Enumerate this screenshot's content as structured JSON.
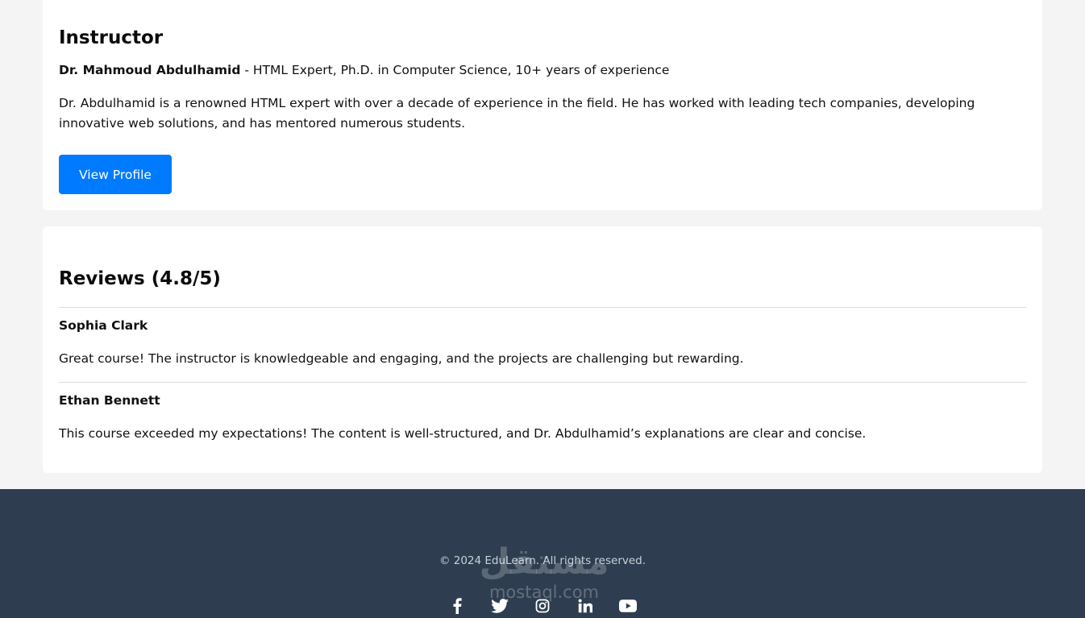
{
  "instructor": {
    "heading": "Instructor",
    "name": "Dr. Mahmoud Abdulhamid",
    "credentials": " - HTML Expert, Ph.D. in Computer Science, 10+ years of experience",
    "bio": "Dr. Abdulhamid is a renowned HTML expert with over a decade of experience in the field. He has worked with leading tech companies, developing innovative web solutions, and has mentored numerous students.",
    "button_label": "View Profile"
  },
  "reviews": {
    "heading": "Reviews (4.8/5)",
    "items": [
      {
        "name": "Sophia Clark",
        "text": "Great course! The instructor is knowledgeable and engaging, and the projects are challenging but rewarding."
      },
      {
        "name": "Ethan Bennett",
        "text": "This course exceeded my expectations! The content is well-structured, and Dr. Abdulhamid’s explanations are clear and concise."
      }
    ]
  },
  "footer": {
    "copyright": "© 2024 EduLearn. All rights reserved.",
    "socials": [
      {
        "icon": "facebook-icon"
      },
      {
        "icon": "twitter-icon"
      },
      {
        "icon": "instagram-icon"
      },
      {
        "icon": "linkedin-icon"
      },
      {
        "icon": "youtube-icon"
      }
    ],
    "watermark": {
      "arabic": "مستقل",
      "latin": "mostaql.com"
    }
  },
  "colors": {
    "accent": "#007bff",
    "footer_bg": "#2e3e50",
    "page_bg": "#f4f4f4"
  }
}
